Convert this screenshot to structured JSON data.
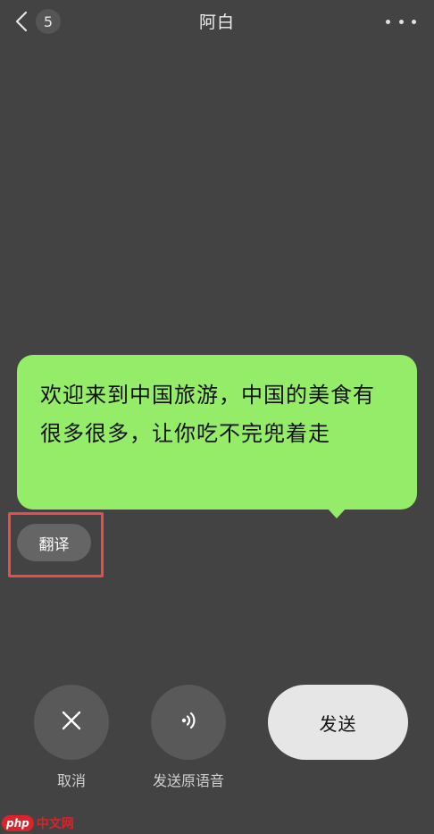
{
  "nav": {
    "back_icon": "chevron-left-icon",
    "unread_count": "5",
    "title": "阿白",
    "more_icon": "more-dots-icon"
  },
  "bubble": {
    "text": "欢迎来到中国旅游，中国的美食有很多很多，让你吃不完兜着走",
    "color": "#95ec69"
  },
  "translate": {
    "label": "翻译",
    "highlight_color": "#e84c4c"
  },
  "actions": {
    "cancel_icon": "close-icon",
    "cancel_label": "取消",
    "send_voice_icon": "voice-wave-icon",
    "send_voice_label": "发送原语音",
    "send_label": "发送"
  },
  "watermark": {
    "logo": "php",
    "text": "中文网"
  },
  "colors": {
    "background": "#434343",
    "circle_button": "#595959",
    "send_button": "#e6e6e6"
  }
}
